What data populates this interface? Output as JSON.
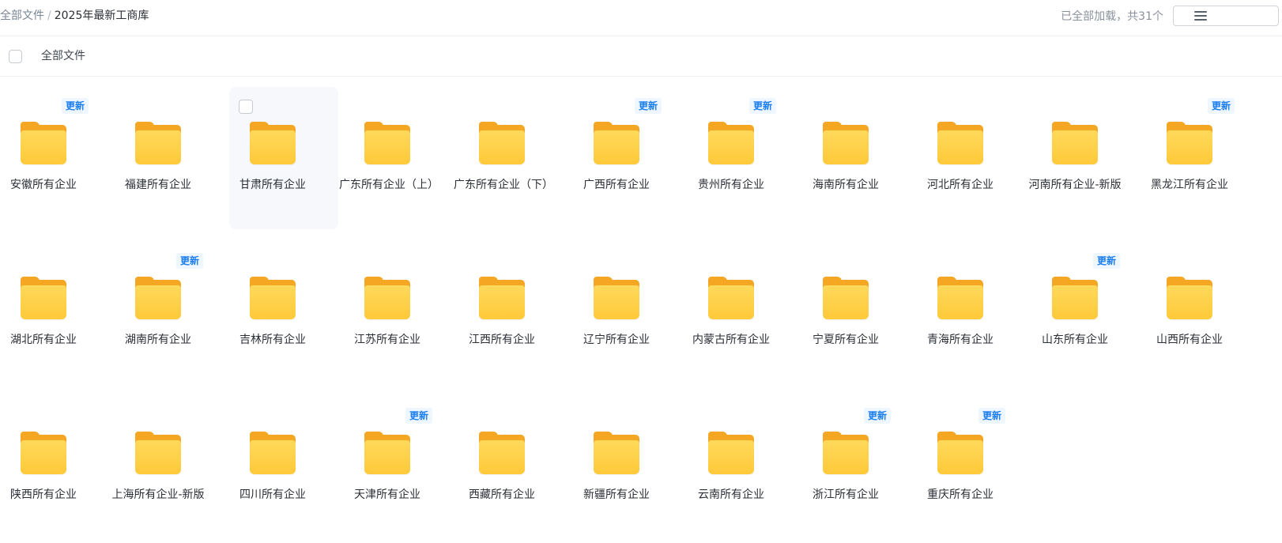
{
  "breadcrumb": {
    "root": "全部文件",
    "separator": "/",
    "current": "2025年最新工商库"
  },
  "status": {
    "text": "已全部加载，共31个"
  },
  "header": {
    "select_all_label": "全部文件"
  },
  "badge_label": "更新",
  "view_modes": [
    "list-view",
    "grid-view"
  ],
  "active_view": "grid-view",
  "folders": [
    {
      "name": "安徽所有企业",
      "badge": "更新"
    },
    {
      "name": "福建所有企业",
      "badge": ""
    },
    {
      "name": "甘肃所有企业",
      "badge": ""
    },
    {
      "name": "广东所有企业（上）",
      "badge": ""
    },
    {
      "name": "广东所有企业（下）",
      "badge": ""
    },
    {
      "name": "广西所有企业",
      "badge": "更新"
    },
    {
      "name": "贵州所有企业",
      "badge": "更新"
    },
    {
      "name": "海南所有企业",
      "badge": ""
    },
    {
      "name": "河北所有企业",
      "badge": ""
    },
    {
      "name": "河南所有企业-新版",
      "badge": ""
    },
    {
      "name": "黑龙江所有企业",
      "badge": "更新"
    },
    {
      "name": "湖北所有企业",
      "badge": ""
    },
    {
      "name": "湖南所有企业",
      "badge": "更新"
    },
    {
      "name": "吉林所有企业",
      "badge": ""
    },
    {
      "name": "江苏所有企业",
      "badge": ""
    },
    {
      "name": "江西所有企业",
      "badge": ""
    },
    {
      "name": "辽宁所有企业",
      "badge": ""
    },
    {
      "name": "内蒙古所有企业",
      "badge": ""
    },
    {
      "name": "宁夏所有企业",
      "badge": ""
    },
    {
      "name": "青海所有企业",
      "badge": ""
    },
    {
      "name": "山东所有企业",
      "badge": "更新"
    },
    {
      "name": "山西所有企业",
      "badge": ""
    },
    {
      "name": "陕西所有企业",
      "badge": ""
    },
    {
      "name": "上海所有企业-新版",
      "badge": ""
    },
    {
      "name": "四川所有企业",
      "badge": ""
    },
    {
      "name": "天津所有企业",
      "badge": "更新"
    },
    {
      "name": "西藏所有企业",
      "badge": ""
    },
    {
      "name": "新疆所有企业",
      "badge": ""
    },
    {
      "name": "云南所有企业",
      "badge": ""
    },
    {
      "name": "浙江所有企业",
      "badge": "更新"
    },
    {
      "name": "重庆所有企业",
      "badge": "更新"
    }
  ],
  "hovered_folder_index": 2
}
